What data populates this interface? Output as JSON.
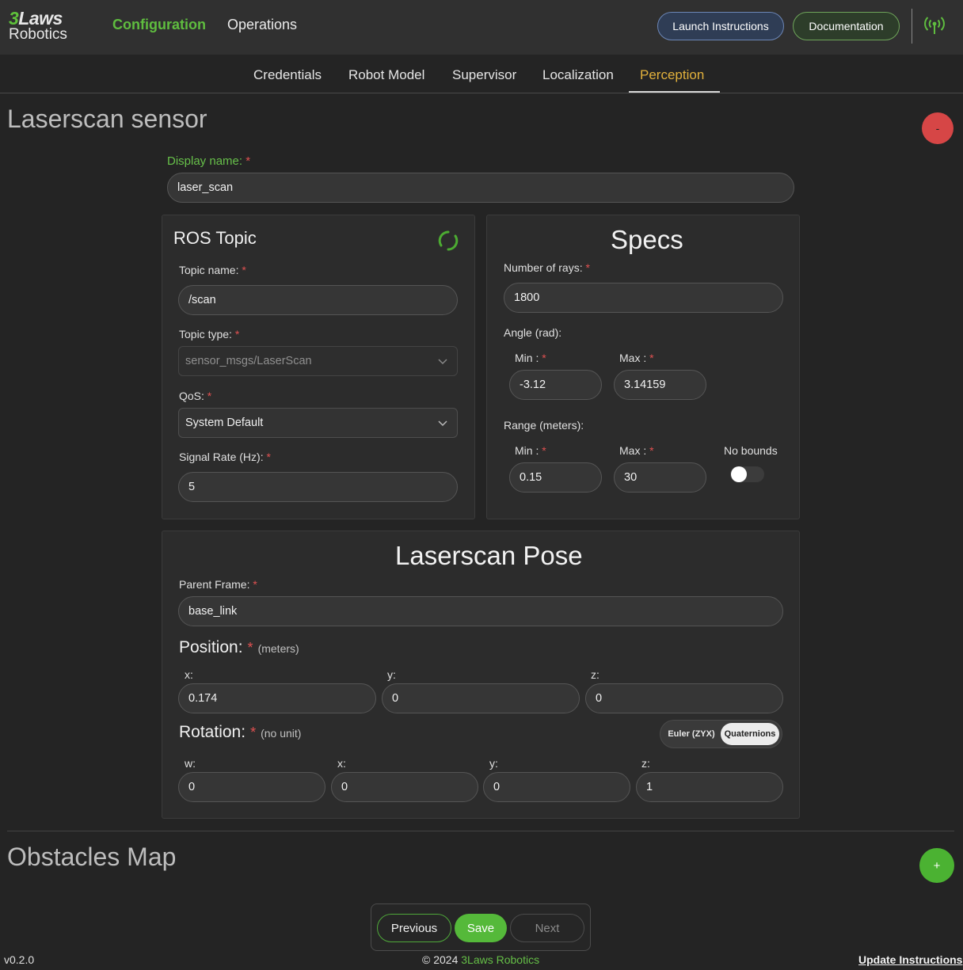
{
  "header": {
    "logo_top": "Laws",
    "logo_three": "3",
    "logo_bottom": "Robotics",
    "nav": [
      "Configuration",
      "Operations"
    ],
    "launch_label": "Launch Instructions",
    "doc_label": "Documentation",
    "signal_icon": "antenna-signal-icon"
  },
  "tabs": [
    "Credentials",
    "Robot Model",
    "Supervisor",
    "Localization",
    "Perception"
  ],
  "active_tab": "Perception",
  "laserscan": {
    "title": "Laserscan sensor",
    "remove_label": "-",
    "display_name_label": "Display name:",
    "display_name": "laser_scan"
  },
  "ros_topic": {
    "title": "ROS Topic",
    "topic_name_label": "Topic name:",
    "topic_name": "/scan",
    "topic_type_label": "Topic type:",
    "topic_type": "sensor_msgs/LaserScan",
    "qos_label": "QoS:",
    "qos": "System Default",
    "rate_label": "Signal Rate (Hz):",
    "rate": "5"
  },
  "specs": {
    "title": "Specs",
    "rays_label": "Number of rays:",
    "rays": "1800",
    "angle_label": "Angle (rad):",
    "angle_min_label": "Min :",
    "angle_min": "-3.12",
    "angle_max_label": "Max :",
    "angle_max": "3.14159",
    "range_label": "Range (meters):",
    "range_min_label": "Min :",
    "range_min": "0.15",
    "range_max_label": "Max :",
    "range_max": "30",
    "no_bounds_label": "No bounds"
  },
  "pose": {
    "title": "Laserscan Pose",
    "parent_label": "Parent Frame:",
    "parent": "base_link",
    "position_label": "Position:",
    "position_unit": "(meters)",
    "pos_x_label": "x:",
    "pos_x": "0.174",
    "pos_y_label": "y:",
    "pos_y": "0",
    "pos_z_label": "z:",
    "pos_z": "0",
    "rotation_label": "Rotation:",
    "rotation_unit": "(no unit)",
    "euler_label": "Euler (ZYX)",
    "quat_label": "Quaternions",
    "rot_w_label": "w:",
    "rot_w": "0",
    "rot_x_label": "x:",
    "rot_x": "0",
    "rot_y_label": "y:",
    "rot_y": "0",
    "rot_z_label": "z:",
    "rot_z": "1"
  },
  "obstacles": {
    "title": "Obstacles Map",
    "add_label": "+"
  },
  "footer": {
    "previous": "Previous",
    "save": "Save",
    "next": "Next",
    "version": "v0.2.0",
    "copyright": "© 2024",
    "brand": "3Laws Robotics",
    "update": "Update Instructions"
  },
  "required_mark": "*",
  "colors": {
    "accent_green": "#5fbd3f",
    "active_tab": "#e2b13c",
    "danger": "#d64646",
    "background": "#242424"
  }
}
